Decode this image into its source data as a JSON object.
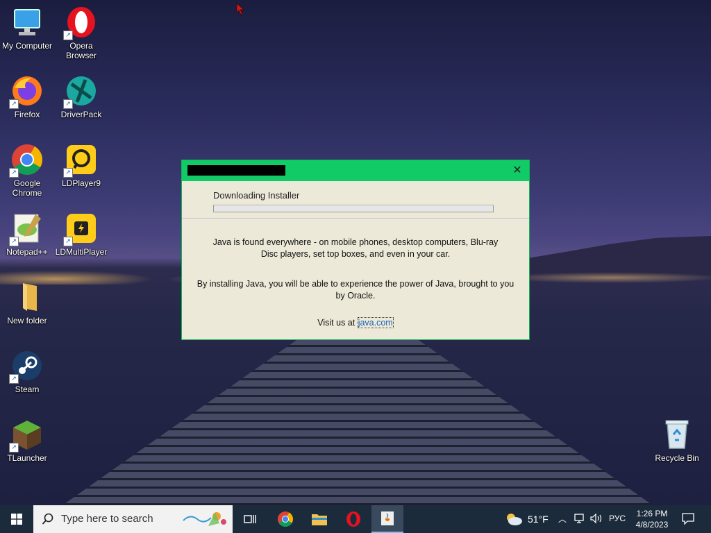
{
  "desktop": {
    "icons_left": [
      {
        "label": "My Computer",
        "icon": "monitor-icon"
      },
      {
        "label": "Opera Browser",
        "icon": "opera-icon"
      },
      {
        "label": "Firefox",
        "icon": "firefox-icon"
      },
      {
        "label": "DriverPack",
        "icon": "driverpack-icon"
      },
      {
        "label": "Google Chrome",
        "icon": "chrome-icon"
      },
      {
        "label": "LDPlayer9",
        "icon": "ldplayer-icon"
      },
      {
        "label": "Notepad++",
        "icon": "notepad-plus-plus-icon"
      },
      {
        "label": "LDMultiPlayer",
        "icon": "ldmultiplayer-icon"
      },
      {
        "label": "New folder",
        "icon": "folder-icon"
      },
      {
        "label": "Steam",
        "icon": "steam-icon"
      },
      {
        "label": "TLauncher",
        "icon": "tlauncher-icon"
      }
    ],
    "recycle_bin": {
      "label": "Recycle Bin",
      "icon": "recycle-bin-icon"
    }
  },
  "dialog": {
    "title_redacted": true,
    "accent_color": "#11cc66",
    "status_text": "Downloading Installer",
    "progress": 0,
    "paragraph1": "Java is found everywhere - on mobile phones, desktop computers, Blu-ray Disc players, set top boxes, and even in your car.",
    "paragraph2": "By installing Java, you will be able to experience the power of Java, brought to you by Oracle.",
    "visit_prefix": "Visit us at ",
    "visit_link": "java.com"
  },
  "taskbar": {
    "search_placeholder": "Type here to search",
    "apps": [
      "task-view-icon",
      "chrome-icon",
      "file-explorer-icon",
      "opera-icon",
      "java-installer-icon"
    ],
    "weather_temp": "51°F",
    "language": "РУС",
    "time": "1:26 PM",
    "date": "4/8/2023"
  }
}
